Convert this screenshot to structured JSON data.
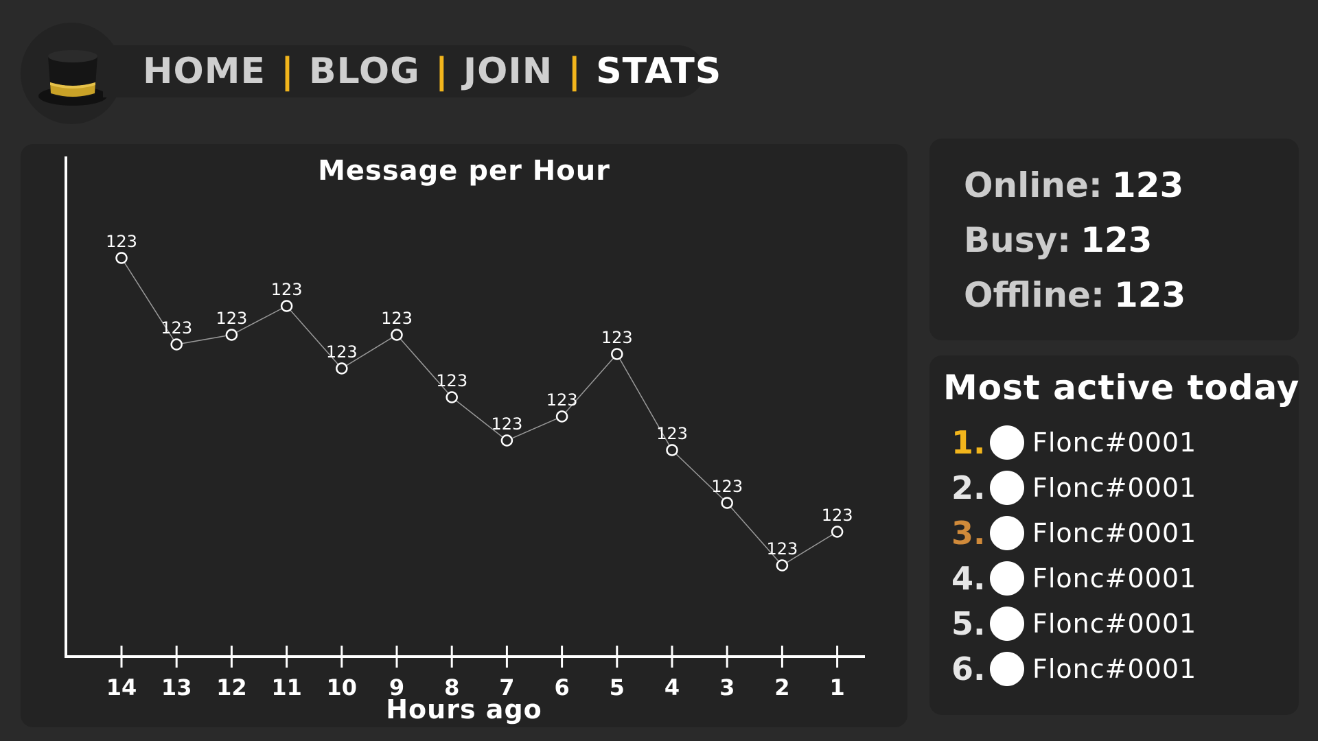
{
  "nav": {
    "links": [
      {
        "label": "HOME",
        "active": false
      },
      {
        "label": "BLOG",
        "active": false
      },
      {
        "label": "JOIN",
        "active": false
      },
      {
        "label": "STATS",
        "active": true
      }
    ],
    "separator": "|",
    "logo_icon": "top-hat-icon",
    "accent_color": "#f2b51c"
  },
  "chart_data": {
    "type": "line",
    "title": "Message per Hour",
    "xlabel": "Hours ago",
    "ylabel": "",
    "categories": [
      "14",
      "13",
      "12",
      "11",
      "10",
      "9",
      "8",
      "7",
      "6",
      "5",
      "4",
      "3",
      "2",
      "1"
    ],
    "values": [
      123,
      123,
      123,
      123,
      123,
      123,
      123,
      123,
      123,
      123,
      123,
      123,
      123,
      123
    ],
    "data_labels": [
      "123",
      "123",
      "123",
      "123",
      "123",
      "123",
      "123",
      "123",
      "123",
      "123",
      "123",
      "123",
      "123",
      "123"
    ],
    "relative_levels": [
      0.83,
      0.65,
      0.67,
      0.73,
      0.6,
      0.67,
      0.54,
      0.45,
      0.5,
      0.63,
      0.43,
      0.32,
      0.19,
      0.26
    ],
    "grid": false,
    "legend": "none"
  },
  "status": {
    "online_label": "Online:",
    "online_value": "123",
    "busy_label": "Busy:",
    "busy_value": "123",
    "offline_label": "Offline:",
    "offline_value": "123"
  },
  "active": {
    "title": "Most active today",
    "users": [
      {
        "rank": "1.",
        "name": "Flonc#0001",
        "rank_color": "#f2b51c"
      },
      {
        "rank": "2.",
        "name": "Flonc#0001",
        "rank_color": "#e6e6e6"
      },
      {
        "rank": "3.",
        "name": "Flonc#0001",
        "rank_color": "#d08a3a"
      },
      {
        "rank": "4.",
        "name": "Flonc#0001",
        "rank_color": "#e6e6e6"
      },
      {
        "rank": "5.",
        "name": "Flonc#0001",
        "rank_color": "#e6e6e6"
      },
      {
        "rank": "6.",
        "name": "Flonc#0001",
        "rank_color": "#e6e6e6"
      }
    ]
  }
}
